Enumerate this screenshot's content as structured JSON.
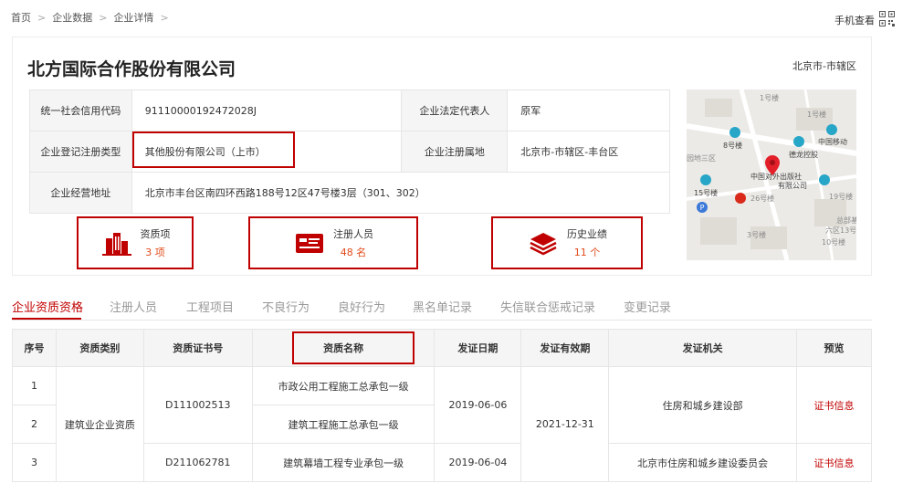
{
  "breadcrumb": {
    "items": [
      "首页",
      "企业数据",
      "企业详情"
    ],
    "separator": ">"
  },
  "header": {
    "mobile_view_label": "手机查看",
    "qr_icon": "qr-code-icon"
  },
  "company": {
    "name": "北方国际合作股份有限公司",
    "region": "北京市-市辖区",
    "info": {
      "credit_code_label": "统一社会信用代码",
      "credit_code": "91110000192472028J",
      "legal_rep_label": "企业法定代表人",
      "legal_rep": "原军",
      "reg_type_label": "企业登记注册类型",
      "reg_type": "其他股份有限公司（上市）",
      "reg_place_label": "企业注册属地",
      "reg_place": "北京市-市辖区-丰台区",
      "address_label": "企业经营地址",
      "address": "北京市丰台区南四环西路188号12区47号楼3层（301、302）"
    },
    "stats": [
      {
        "label": "资质项",
        "value": "3 项",
        "icon": "buildings-icon"
      },
      {
        "label": "注册人员",
        "value": "48 名",
        "icon": "id-card-icon"
      },
      {
        "label": "历史业绩",
        "value": "11 个",
        "icon": "layers-icon"
      }
    ]
  },
  "map": {
    "labels": [
      "1号楼",
      "1号楼",
      "8号楼",
      "中国移动",
      "德龙控股",
      "园地三区",
      "中国对外出版社",
      "有限公司",
      "15号楼",
      "26号楼",
      "19号楼",
      "总部基",
      "六区13号",
      "3号楼",
      "10号楼"
    ]
  },
  "tabs": [
    "企业资质资格",
    "注册人员",
    "工程项目",
    "不良行为",
    "良好行为",
    "黑名单记录",
    "失信联合惩戒记录",
    "变更记录"
  ],
  "qualification_table": {
    "headers": [
      "序号",
      "资质类别",
      "资质证书号",
      "资质名称",
      "发证日期",
      "发证有效期",
      "发证机关",
      "预览"
    ],
    "category": "建筑业企业资质",
    "rows": [
      {
        "index": "1",
        "cert_no": "D111002513",
        "name": "市政公用工程施工总承包一级",
        "issue_date": "2019-06-06",
        "valid_until": "2021-12-31",
        "authority": "住房和城乡建设部",
        "preview": "证书信息"
      },
      {
        "index": "2",
        "cert_no": "D111002513",
        "name": "建筑工程施工总承包一级",
        "issue_date": "2019-06-06",
        "valid_until": "2021-12-31",
        "authority": "住房和城乡建设部",
        "preview": "证书信息"
      },
      {
        "index": "3",
        "cert_no": "D211062781",
        "name": "建筑幕墙工程专业承包一级",
        "issue_date": "2019-06-04",
        "valid_until": "2021-12-31",
        "authority": "北京市住房和城乡建设委员会",
        "preview": "证书信息"
      }
    ]
  },
  "colors": {
    "accent": "#c00000",
    "value_orange": "#e24a1a",
    "label_bg": "#f5f5f5",
    "border": "#e6e6e6"
  }
}
